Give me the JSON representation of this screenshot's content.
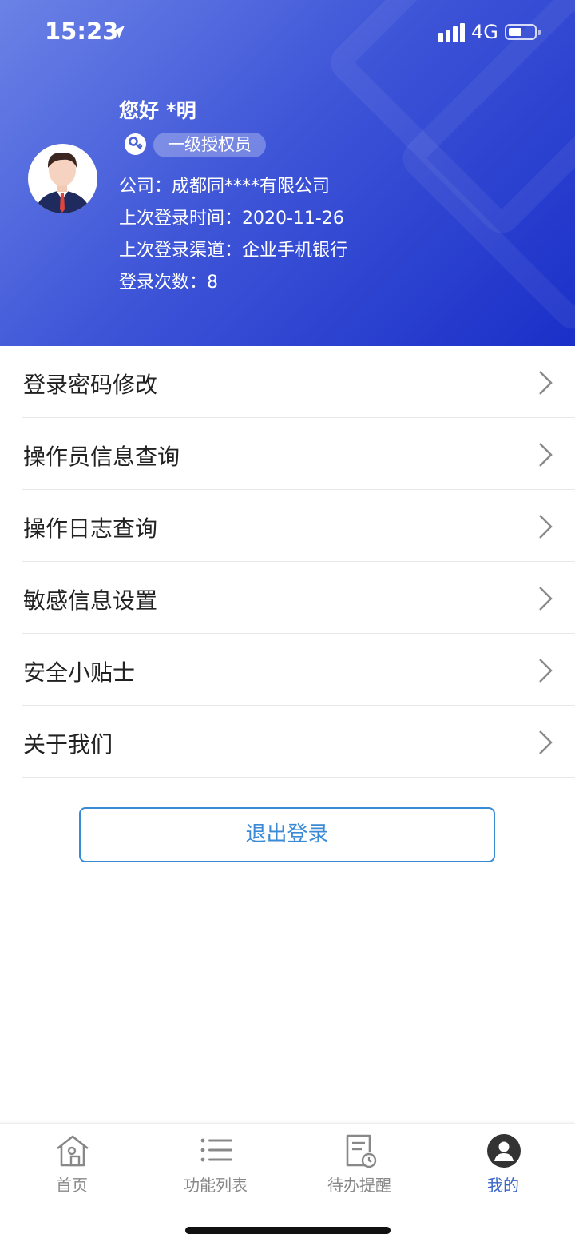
{
  "status_bar": {
    "time": "15:23",
    "network": "4G",
    "battery_level": 0.5
  },
  "profile": {
    "greeting": "您好 *明",
    "role_badge": "一级授权员",
    "company_line": "公司：成都同****有限公司",
    "last_login_time_line": "上次登录时间：2020-11-26",
    "last_login_channel_line": "上次登录渠道：企业手机银行",
    "login_count_line": "登录次数：8"
  },
  "menu": {
    "items": [
      {
        "label": "登录密码修改"
      },
      {
        "label": "操作员信息查询"
      },
      {
        "label": "操作日志查询"
      },
      {
        "label": "敏感信息设置"
      },
      {
        "label": "安全小贴士"
      },
      {
        "label": "关于我们"
      }
    ]
  },
  "logout_label": "退出登录",
  "tabbar": {
    "tabs": [
      {
        "label": "首页",
        "icon": "home-icon"
      },
      {
        "label": "功能列表",
        "icon": "list-icon"
      },
      {
        "label": "待办提醒",
        "icon": "document-clock-icon"
      },
      {
        "label": "我的",
        "icon": "user-icon",
        "active": true
      }
    ]
  },
  "colors": {
    "header_gradient_start": "#6b82e6",
    "header_gradient_end": "#1a2fc8",
    "accent": "#3a8ad6",
    "tab_active": "#3a66c8"
  }
}
